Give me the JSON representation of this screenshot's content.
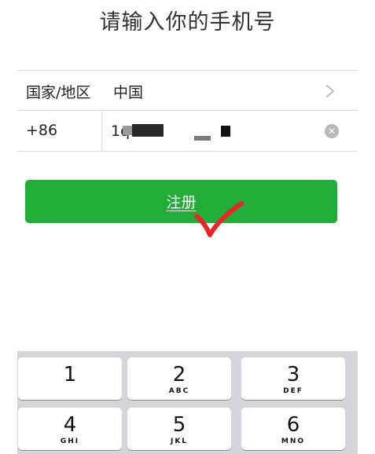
{
  "header": {
    "title": "请输入你的手机号"
  },
  "form": {
    "country_label": "国家/地区",
    "country_value": "中国",
    "country_code": "+86",
    "phone_value": "1q"
  },
  "actions": {
    "register_label": "注册"
  },
  "keypad": {
    "keys": [
      {
        "digit": "1",
        "letters": ""
      },
      {
        "digit": "2",
        "letters": "ABC"
      },
      {
        "digit": "3",
        "letters": "DEF"
      },
      {
        "digit": "4",
        "letters": "GHI"
      },
      {
        "digit": "5",
        "letters": "JKL"
      },
      {
        "digit": "6",
        "letters": "MNO"
      }
    ]
  },
  "icons": {
    "chevron": "chevron-right-icon",
    "clear": "clear-icon",
    "annotation": "checkmark-annotation"
  },
  "colors": {
    "accent": "#22ac38",
    "annotation": "#e8262a"
  }
}
